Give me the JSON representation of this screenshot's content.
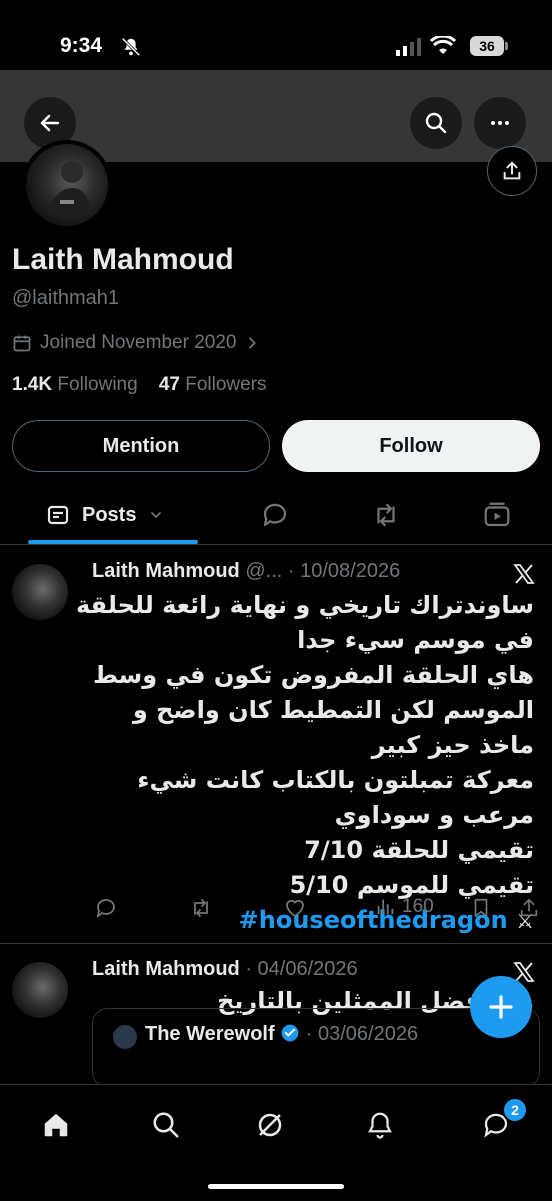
{
  "status_bar": {
    "time": "9:34",
    "battery": "36"
  },
  "profile": {
    "name": "Laith Mahmoud",
    "handle": "@laithmah1",
    "joined": "Joined November 2020",
    "following_count": "1.4K",
    "following_label": "Following",
    "followers_count": "47",
    "followers_label": "Followers"
  },
  "buttons": {
    "mention": "Mention",
    "follow": "Follow"
  },
  "tabs": {
    "posts": "Posts"
  },
  "posts": [
    {
      "author": "Laith Mahmoud",
      "handle": "@...",
      "date": "· 10/08/2026",
      "lines": [
        "ساوندتراك تاريخي و نهاية رائعة للحلقة في موسم سيء جدا",
        "هاي الحلقة المفروض تكون في وسط الموسم لكن التمطيط كان واضح و ماخذ حيز كبير",
        "معركة تمبلتون بالكتاب كانت شيء مرعب و سوداوي",
        "تقيمي للحلقة 7/10",
        "تقيمي للموسم 5/10"
      ],
      "hashtag": "#houseofthedragon",
      "views": "160"
    },
    {
      "author": "Laith Mahmoud",
      "date": "· 04/06/2026",
      "text": "من افضل الممثلين بالتاريخ",
      "quote": {
        "author": "The Werewolf",
        "date": "· 03/06/2026"
      }
    }
  ],
  "messages_badge": "2",
  "colors": {
    "accent": "#1d9bf0",
    "muted": "#71767b",
    "text": "#e7e9ea"
  }
}
